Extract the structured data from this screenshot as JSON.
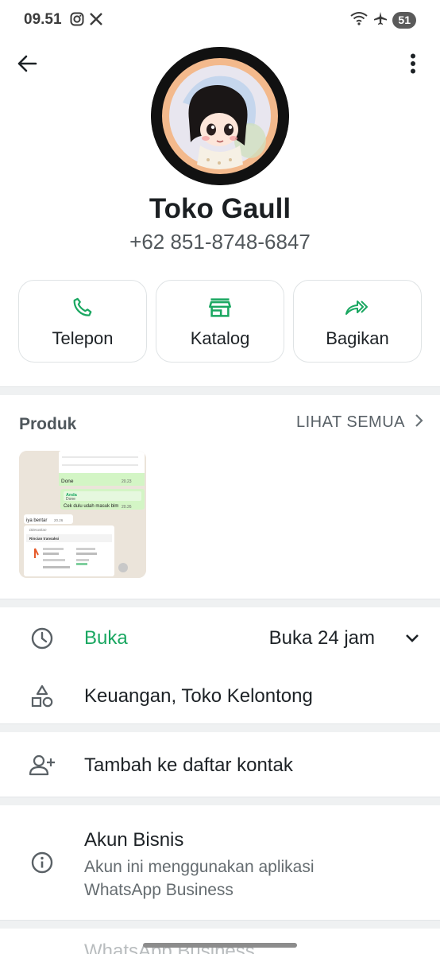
{
  "status_bar": {
    "time": "09.51",
    "battery": "51",
    "icons": [
      "instagram-icon",
      "x-icon",
      "wifi-icon",
      "airplane-icon"
    ]
  },
  "header": {
    "back_icon": "arrow-left-icon",
    "menu_icon": "more-vert-icon"
  },
  "profile": {
    "name": "Toko Gaull",
    "phone": "+62 851-8748-6847"
  },
  "actions": [
    {
      "label": "Telepon",
      "icon": "phone-icon"
    },
    {
      "label": "Katalog",
      "icon": "storefront-icon"
    },
    {
      "label": "Bagikan",
      "icon": "forward-icon"
    }
  ],
  "products": {
    "title": "Produk",
    "see_all": "LIHAT SEMUA",
    "thumbnail": {
      "rows": [
        "Done",
        "Anda",
        "Done",
        "Cek dulu udah masuk blm",
        "iya bentar",
        "Diteruskan",
        "Rincian transaksi"
      ],
      "times": [
        "20.23",
        "20.26",
        "20.26"
      ]
    }
  },
  "info": {
    "hours_status": "Buka",
    "hours_value": "Buka 24 jam",
    "category": "Keuangan, Toko Kelontong",
    "add_contact": "Tambah ke daftar kontak",
    "business_title": "Akun Bisnis",
    "business_desc": "Akun ini menggunakan aplikasi WhatsApp Business",
    "next_peek": "WhatsApp Business"
  },
  "colors": {
    "accent": "#1aa761",
    "divider": "#eff1f2",
    "text_primary": "#1d2226",
    "text_secondary": "#656c70"
  }
}
